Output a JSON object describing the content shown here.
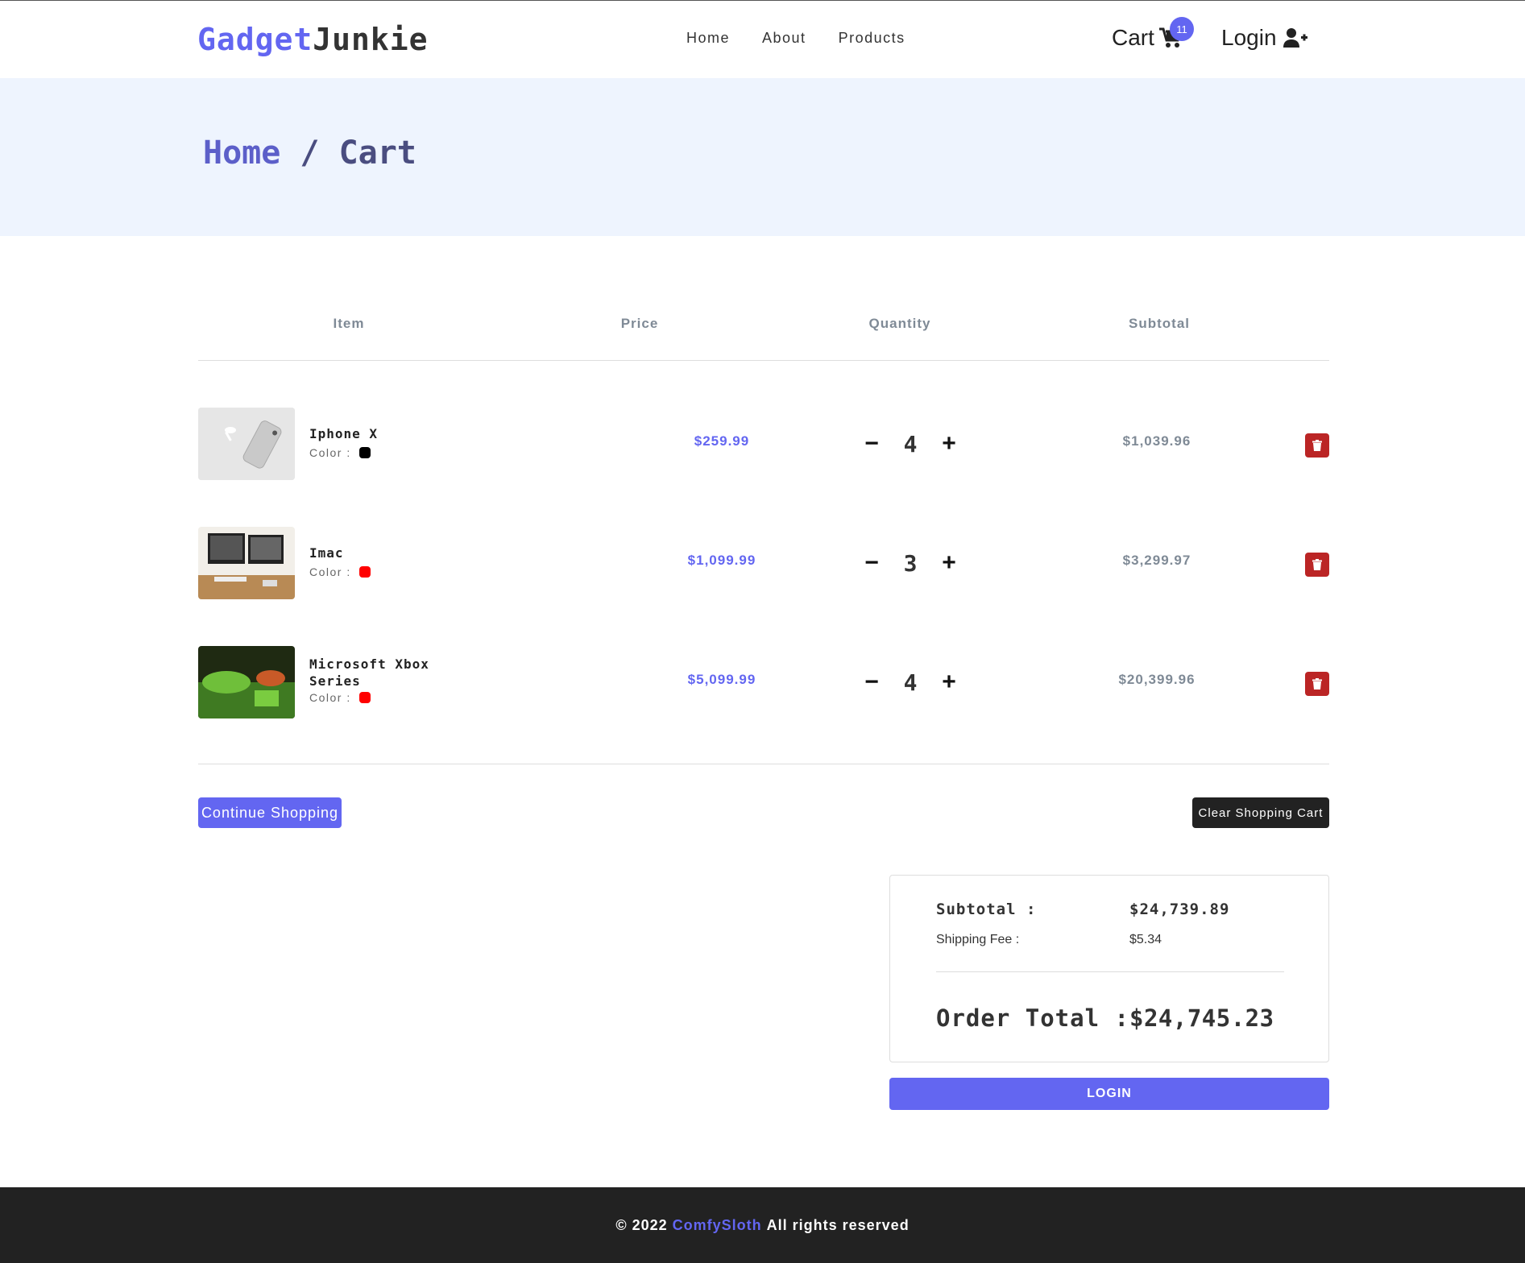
{
  "navbar": {
    "logo_part1": "Gadget",
    "logo_part2": "Junkie",
    "links": [
      "Home",
      "About",
      "Products"
    ],
    "cart_label": "Cart",
    "cart_count": "11",
    "login_label": "Login"
  },
  "hero": {
    "home": "Home",
    "separator": " / ",
    "current": "Cart"
  },
  "table": {
    "headers": [
      "Item",
      "Price",
      "Quantity",
      "Subtotal"
    ],
    "rows": [
      {
        "name": "Iphone X",
        "color_label": "Color :",
        "color": "#000000",
        "price": "$259.99",
        "quantity": "4",
        "subtotal": "$1,039.96"
      },
      {
        "name": "Imac",
        "color_label": "Color :",
        "color": "#ff0000",
        "price": "$1,099.99",
        "quantity": "3",
        "subtotal": "$3,299.97"
      },
      {
        "name": "Microsoft Xbox Series",
        "color_label": "Color :",
        "color": "#ff0000",
        "price": "$5,099.99",
        "quantity": "4",
        "subtotal": "$20,399.96"
      }
    ]
  },
  "actions": {
    "continue_label": "Continue Shopping",
    "clear_label": "Clear Shopping Cart"
  },
  "totals": {
    "subtotal_label": "Subtotal :",
    "subtotal_value": "$24,739.89",
    "shipping_label": "Shipping Fee :",
    "shipping_value": "$5.34",
    "order_label": "Order Total :",
    "order_value": "$24,745.23",
    "login_button": "LOGIN"
  },
  "footer": {
    "prefix": "© 2022",
    "brand": "ComfySloth",
    "suffix": "All rights reserved"
  },
  "colors": {
    "accent": "#6366f1",
    "hero_bg": "#eef4fe",
    "delete": "#bb2525",
    "footer_bg": "#222222"
  }
}
